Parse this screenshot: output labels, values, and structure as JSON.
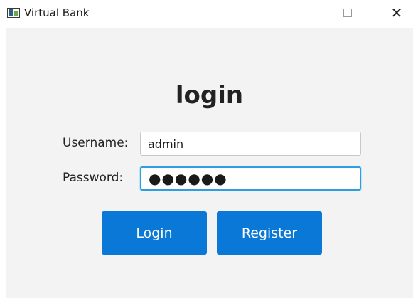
{
  "window": {
    "title": "Virtual Bank",
    "icon": "app-window-icon",
    "controls": {
      "minimize": "minimize-icon",
      "maximize": "maximize-icon",
      "close": "close-icon"
    }
  },
  "main": {
    "heading": "login",
    "username": {
      "label": "Username:",
      "value": "admin"
    },
    "password": {
      "label": "Password:",
      "value": "●●●●●●"
    },
    "buttons": {
      "login": "Login",
      "register": "Register"
    }
  },
  "colors": {
    "accent": "#0a78d7",
    "focus_border": "#2d9fe0",
    "content_background": "#f3f3f3"
  }
}
